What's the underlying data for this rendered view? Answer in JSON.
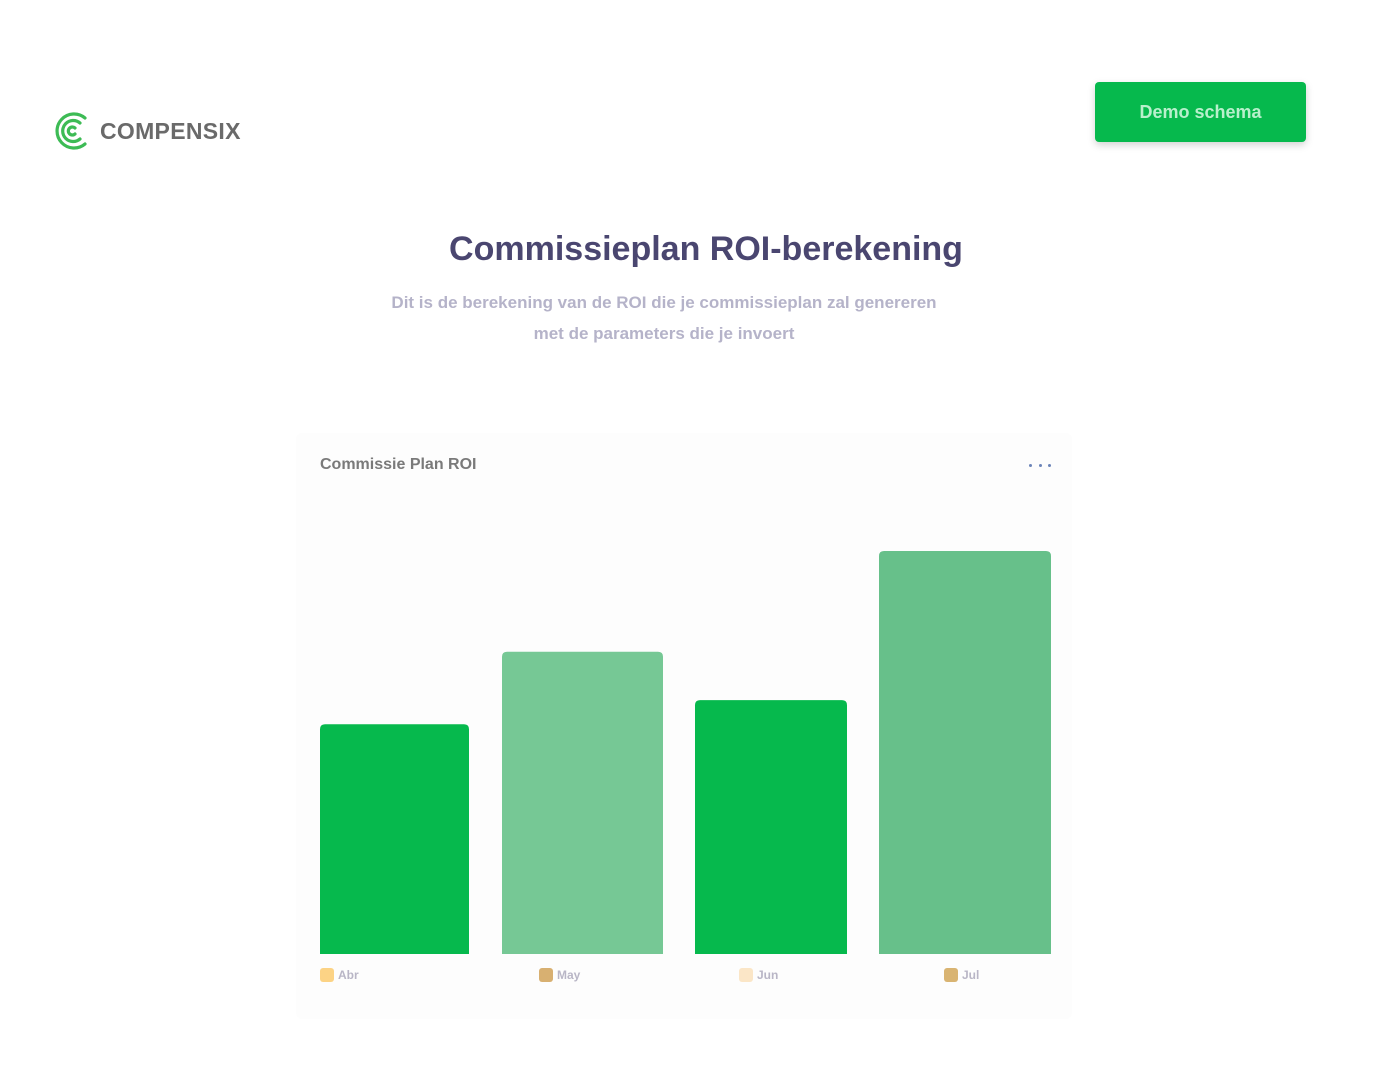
{
  "header": {
    "brand_name": "COMPENSIX",
    "logo_icon": "compensix-logo-icon",
    "brand_color": "#3dbb55",
    "demo_button_label": "Demo schema"
  },
  "hero": {
    "title": "Commissieplan ROI-berekening",
    "subtitle_line1": "Dit is de berekening van de ROI die je commissieplan zal genereren",
    "subtitle_line2": "met de parameters die je invoert"
  },
  "chart_card": {
    "title": "Commissie Plan ROI",
    "menu_icon": "more-horizontal-icon"
  },
  "colors": {
    "accent": "#06b94d",
    "title": "#4a4670",
    "subtitle": "#b5b3c9"
  },
  "chart_data": {
    "type": "bar",
    "categories": [
      "Abr",
      "May",
      "Jun",
      "Jul"
    ],
    "values": [
      57,
      75,
      63,
      100
    ],
    "ylim": [
      0,
      100
    ],
    "grid": false,
    "legend": "bottom",
    "bar_colors": [
      "#06b94d",
      "#76c895",
      "#06b94d",
      "#67c08a"
    ],
    "legend_colors": [
      "#fcd385",
      "#d8b071",
      "#fbe6c7",
      "#d9b472"
    ],
    "title": "Commissie Plan ROI",
    "xlabel": "",
    "ylabel": ""
  }
}
